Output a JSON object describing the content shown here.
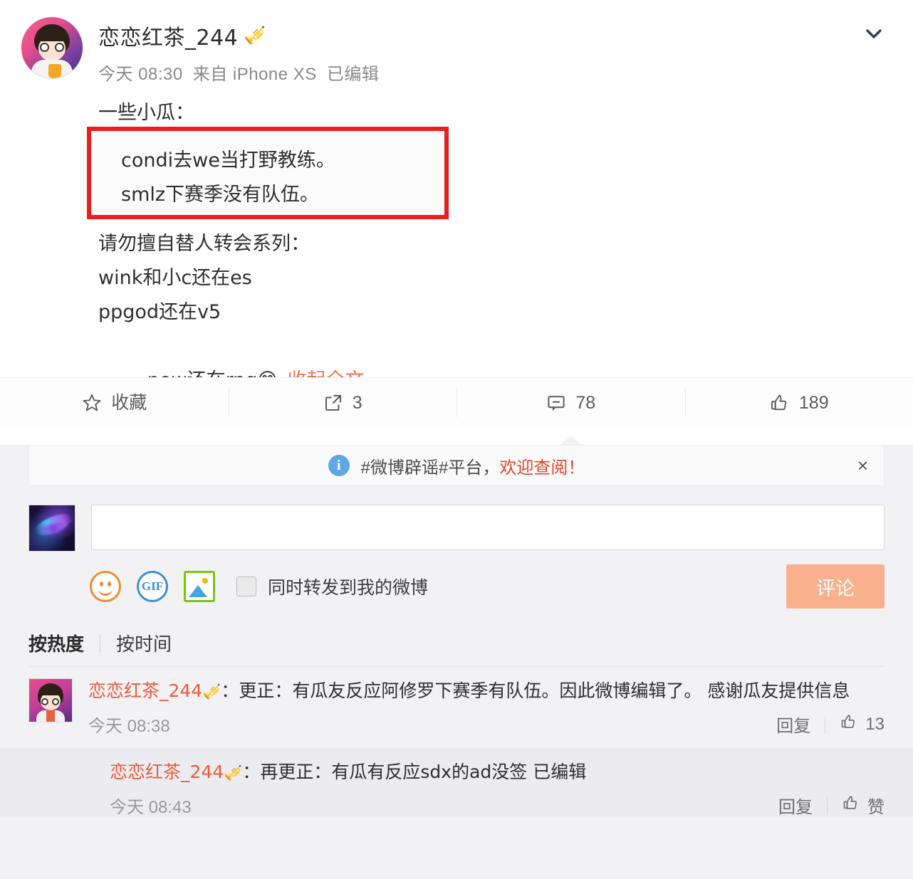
{
  "post": {
    "username": "恋恋红茶_244",
    "badge_emoji": "🎺",
    "time": "今天 08:30",
    "source": "来自 iPhone XS",
    "edited": "已编辑",
    "intro_line": "一些小瓜：",
    "highlight_lines": [
      "condi去we当打野教练。",
      "smlz下赛季没有队伍。"
    ],
    "lines": [
      "请勿擅自替人转会系列：",
      "wink和小c还在es",
      "ppgod还在v5"
    ],
    "last_line": "new还在rng",
    "last_line_emoji": "😙",
    "collapse_label": "收起全文",
    "collapse_caret": "︿",
    "chevron_icon": "chevron-down-icon",
    "annotation_color": "#ee1d1d"
  },
  "actions": {
    "favorite": {
      "label": "收藏",
      "icon": "star-icon"
    },
    "share": {
      "count": "3",
      "icon": "share-icon"
    },
    "comment": {
      "count": "78",
      "icon": "comment-icon"
    },
    "like": {
      "count": "189",
      "icon": "thumbs-up-icon"
    }
  },
  "notice": {
    "icon": "info-icon",
    "text": "#微博辟谣#平台，",
    "link": "欢迎查阅！",
    "close_icon": "×",
    "link_color": "#e8452c"
  },
  "compose": {
    "placeholder": "",
    "value": "",
    "tools": {
      "emoji": "emoji-icon",
      "gif": "GIF",
      "image": "image-icon"
    },
    "checkbox_label": "同时转发到我的微博",
    "checkbox_checked": false,
    "submit_label": "评论",
    "submit_color": "#f9b08c"
  },
  "sort": {
    "tabs": [
      {
        "label": "按热度",
        "active": true
      },
      {
        "label": "按时间",
        "active": false
      }
    ]
  },
  "comments": [
    {
      "user": "恋恋红茶_244",
      "badge_emoji": "🎺",
      "separator": "：",
      "text": "更正：有瓜友反应阿修罗下赛季有队伍。因此微博编辑了。 感谢瓜友提供信息",
      "time": "今天 08:38",
      "reply_label": "回复",
      "like_icon": "thumbs-up-icon",
      "like_count": "13"
    },
    {
      "user": "恋恋红茶_244",
      "badge_emoji": "🎺",
      "separator": "：",
      "text": "再更正：有瓜有反应sdx的ad没签 已编辑",
      "time": "今天 08:43",
      "reply_label": "回复",
      "like_icon": "thumbs-up-icon",
      "like_count": "赞"
    }
  ]
}
